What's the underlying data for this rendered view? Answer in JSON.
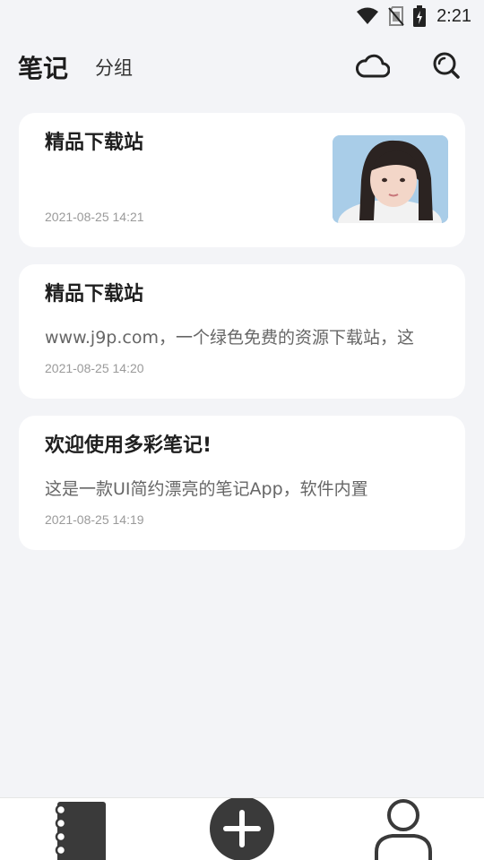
{
  "status_bar": {
    "time": "2:21",
    "icons": [
      "wifi-icon",
      "no-sim-icon",
      "battery-charging-icon"
    ]
  },
  "header": {
    "title": "笔记",
    "group_tab": "分组",
    "icons": [
      "cloud-sync-icon",
      "search-icon"
    ]
  },
  "notes": [
    {
      "title": "精品下载站",
      "preview": "",
      "date": "2021-08-25 14:21",
      "has_image": true
    },
    {
      "title": "精品下载站",
      "preview": "www.j9p.com，一个绿色免费的资源下载站，这",
      "date": "2021-08-25 14:20",
      "has_image": false
    },
    {
      "title": "欢迎使用多彩笔记!",
      "preview": "这是一款UI简约漂亮的笔记App，软件内置",
      "date": "2021-08-25 14:19",
      "has_image": false
    }
  ],
  "bottom_nav": {
    "items": [
      "notebook-icon",
      "add-note-icon",
      "profile-icon"
    ]
  },
  "colors": {
    "background": "#f3f4f7",
    "card": "#ffffff",
    "icon_dark": "#3a3a3a"
  }
}
